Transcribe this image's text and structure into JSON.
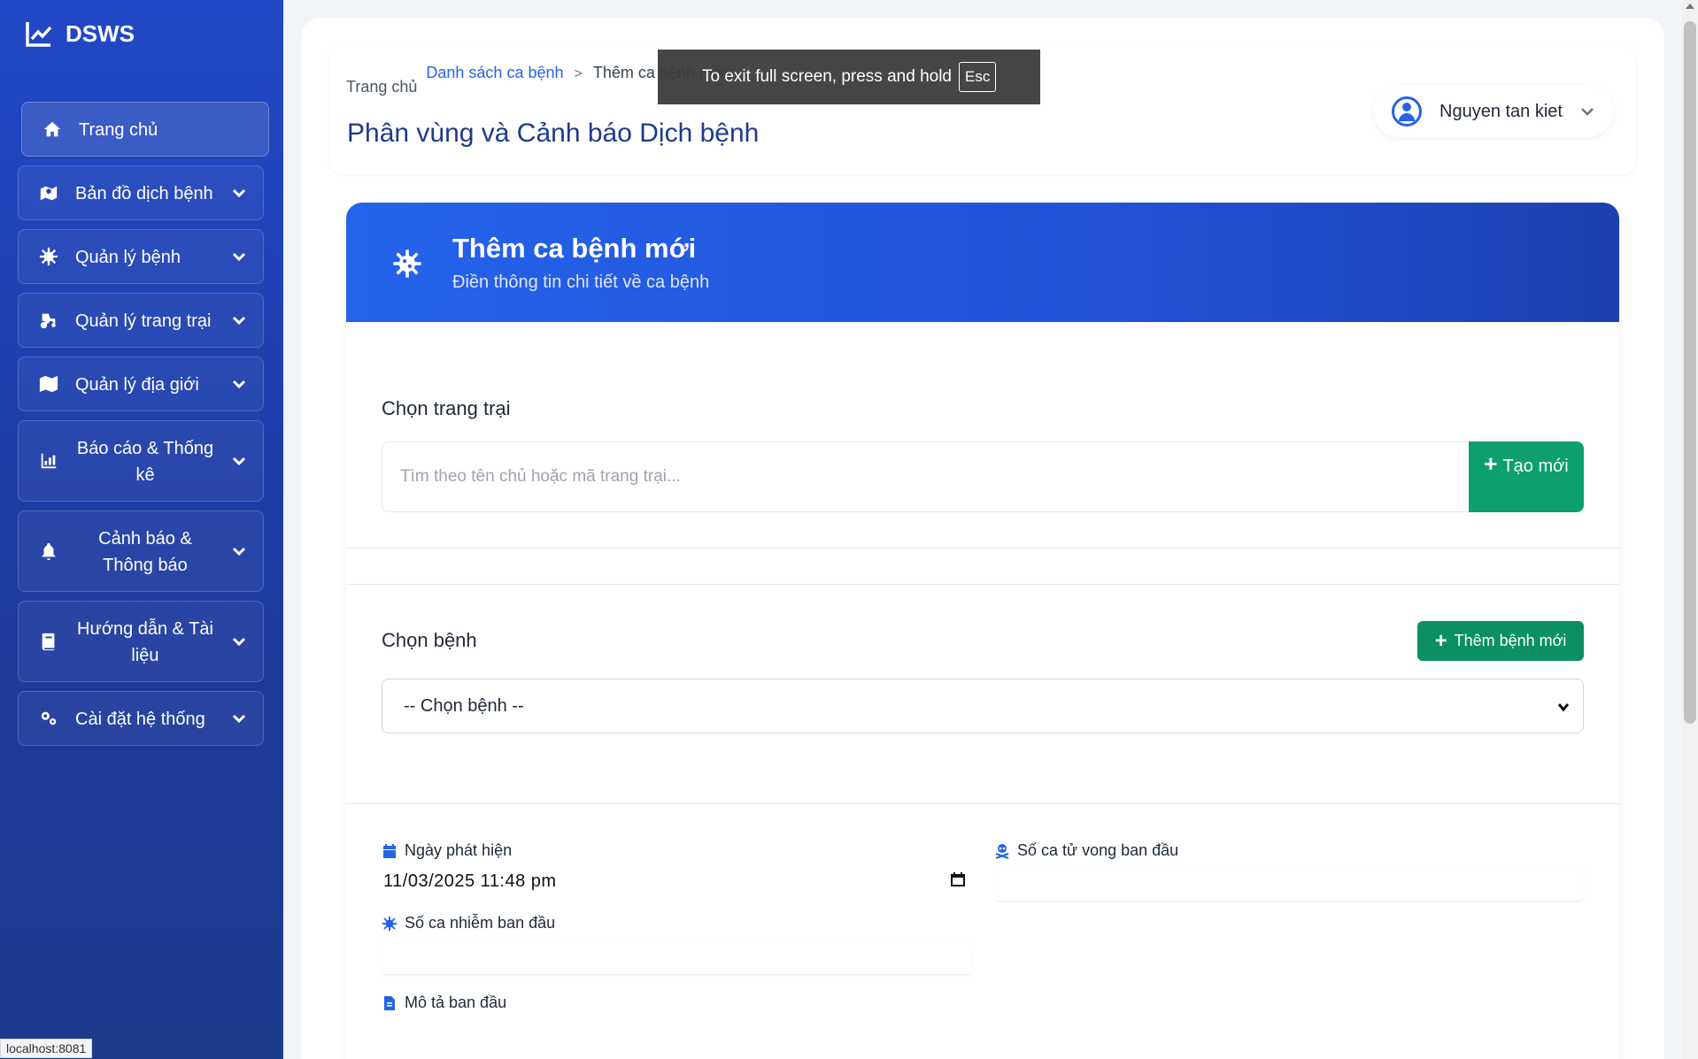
{
  "brand": {
    "name": "DSWS",
    "icon": "chart-line-icon"
  },
  "sidebar": {
    "items": [
      {
        "label": "Trang chủ",
        "icon": "home-icon"
      },
      {
        "label": "Bản đồ dịch bệnh",
        "icon": "map-marked-icon"
      },
      {
        "label": "Quản lý bệnh",
        "icon": "virus-icon"
      },
      {
        "label": "Quản lý trang trại",
        "icon": "tractor-icon"
      },
      {
        "label": "Quản lý địa giới",
        "icon": "map-icon"
      },
      {
        "label": "Báo cáo & Thống kê",
        "icon": "chart-bar-icon"
      },
      {
        "label": "Cảnh báo & Thông báo",
        "icon": "bell-icon"
      },
      {
        "label": "Hướng dẫn & Tài liệu",
        "icon": "book-icon"
      },
      {
        "label": "Cài đặt hệ thống",
        "icon": "cogs-icon"
      }
    ]
  },
  "breadcrumb": {
    "home": "Trang chủ",
    "list": "Danh sách ca bệnh",
    "separator": ">",
    "current": "Thêm ca bệnh mới"
  },
  "page_title": "Phân vùng và Cảnh báo Dịch bệnh",
  "user": {
    "name": "Nguyen tan kiet"
  },
  "fullscreen_toast": {
    "text": "To exit full screen, press and hold",
    "key": "Esc"
  },
  "form": {
    "title": "Thêm ca bệnh mới",
    "subtitle": "Điền thông tin chi tiết về ca bệnh",
    "farm": {
      "label": "Chọn trang trại",
      "search_placeholder": "Tìm theo tên chủ hoặc mã trang trại...",
      "create_label": "Tạo mới"
    },
    "disease": {
      "label": "Chọn bệnh",
      "add_label": "Thêm bệnh mới",
      "selected": "-- Chọn bệnh --"
    },
    "detected_date": {
      "label": "Ngày phát hiện",
      "value": "11/03/2025 11:48 pm"
    },
    "initial_deaths": {
      "label": "Số ca tử vong ban đầu"
    },
    "initial_infected": {
      "label": "Số ca nhiễm ban đầu"
    },
    "initial_description": {
      "label": "Mô tả ban đầu"
    }
  },
  "status_bar": {
    "url": "localhost:8081"
  },
  "colors": {
    "sidebar": "#2148c6",
    "primary": "#2563eb",
    "success": "#0e9f6e",
    "title": "#1e3a8a"
  }
}
